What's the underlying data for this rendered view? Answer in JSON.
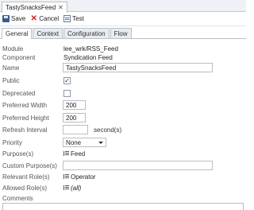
{
  "document_tab": {
    "title": "TastySnacksFeed",
    "close": "✕"
  },
  "toolbar": {
    "save": "Save",
    "cancel": "Cancel",
    "test": "Test"
  },
  "tabs": [
    "General",
    "Context",
    "Configuration",
    "Flow"
  ],
  "active_tab": "General",
  "form": {
    "module": {
      "label": "Module",
      "value": "lee_wrk/RSS_Feed"
    },
    "component": {
      "label": "Component",
      "value": "Syndication Feed"
    },
    "name": {
      "label": "Name",
      "value": "TastySnacksFeed"
    },
    "public": {
      "label": "Public",
      "checked": true
    },
    "deprecated": {
      "label": "Deprecated",
      "checked": false
    },
    "preferred_width": {
      "label": "Preferred Width",
      "value": "200"
    },
    "preferred_height": {
      "label": "Preferred Height",
      "value": "200"
    },
    "refresh_interval": {
      "label": "Refresh Interval",
      "value": "",
      "unit": "second(s)"
    },
    "priority": {
      "label": "Priority",
      "value": "None"
    },
    "purposes": {
      "label": "Purpose(s)",
      "value": "Feed"
    },
    "custom_purposes": {
      "label": "Custom Purpose(s)",
      "value": ""
    },
    "relevant_roles": {
      "label": "Relevant Role(s)",
      "value": "Operator"
    },
    "allowed_roles": {
      "label": "Allowed Role(s)",
      "value": "(all)"
    },
    "comments": {
      "label": "Comments"
    }
  }
}
